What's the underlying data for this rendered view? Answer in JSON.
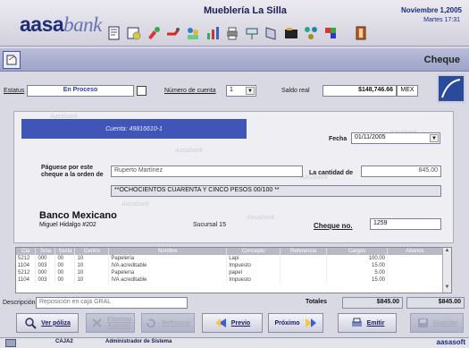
{
  "header": {
    "logo_aasa": "aasa",
    "logo_bank": "bank",
    "company": "Mueblería La Silla",
    "date": "Noviembre 1,2005",
    "time": "Martes 17:31",
    "toolbar_icons": [
      "notes-icon",
      "document-money-icon",
      "paint-icon",
      "tools-icon",
      "users-icon",
      "chart-icon",
      "printer-icon",
      "flow-icon",
      "book-icon",
      "folder-icon",
      "network-icon",
      "puzzle-icon",
      "exit-icon"
    ]
  },
  "titlebar": {
    "title": "Cheque"
  },
  "status": {
    "estatus_label": "Estatus",
    "estatus_value": "En Proceso",
    "cuenta_label": "Número de cuenta",
    "cuenta_value": "1",
    "saldo_label": "Saldo real",
    "saldo_value": "$148,746.66",
    "currency": "MEX"
  },
  "cheque": {
    "account": "Cuenta: 49816610-1",
    "fecha_label": "Fecha",
    "fecha_value": "01/11/2005",
    "payee_label_1": "Páguese por este",
    "payee_label_2": "cheque a la orden de",
    "payee_value": "Ruperto Martínez",
    "amount_label": "La cantidad de",
    "amount_value": "845.00",
    "amount_words": "**OCHOCIENTOS CUARENTA Y CINCO PESOS 00/100 **",
    "bank_name": "Banco Mexicano",
    "bank_address": "Miguel Hidalgo #202",
    "branch": "Sucursal 15",
    "cheque_no_label": "Cheque no.",
    "cheque_no_value": "1259",
    "watermark": "Aasabank"
  },
  "table": {
    "columns": [
      "Cta",
      "Scta",
      "Sscta",
      "Centro",
      "Nombre",
      "Concepto",
      "Referencia",
      "Cargos",
      "Abonos"
    ],
    "rows": [
      [
        "5212",
        "000",
        "00",
        "10",
        "Papelería",
        "Lapi",
        "",
        "100.00",
        ""
      ],
      [
        "1104",
        "003",
        "00",
        "10",
        "IVA acreditable",
        "Impuesto",
        "",
        "15.00",
        ""
      ],
      [
        "5212",
        "000",
        "00",
        "10",
        "Papelería",
        "papel",
        "",
        "5.00",
        ""
      ],
      [
        "1104",
        "003",
        "00",
        "10",
        "IVA acreditable",
        "Impuesto",
        "",
        "15.00",
        ""
      ]
    ]
  },
  "footer": {
    "desc_label": "Descripción",
    "desc_value": "Reposición en caja GRAL",
    "totals_label": "Totales",
    "total_cargos": "$845.00",
    "total_abonos": "$845.00"
  },
  "buttons": {
    "ver_poliza": "Ver póliza",
    "eliminar_asiento": "Eliminar Asiento",
    "refrescar": "Refrescar",
    "previo": "Previo",
    "proximo": "Próximo",
    "emitir": "Emitir",
    "guardar": "Guardar"
  },
  "statusbar": {
    "caja": "CAJA2",
    "user": "Administrador de Sistema",
    "brand": "aasasoft"
  }
}
